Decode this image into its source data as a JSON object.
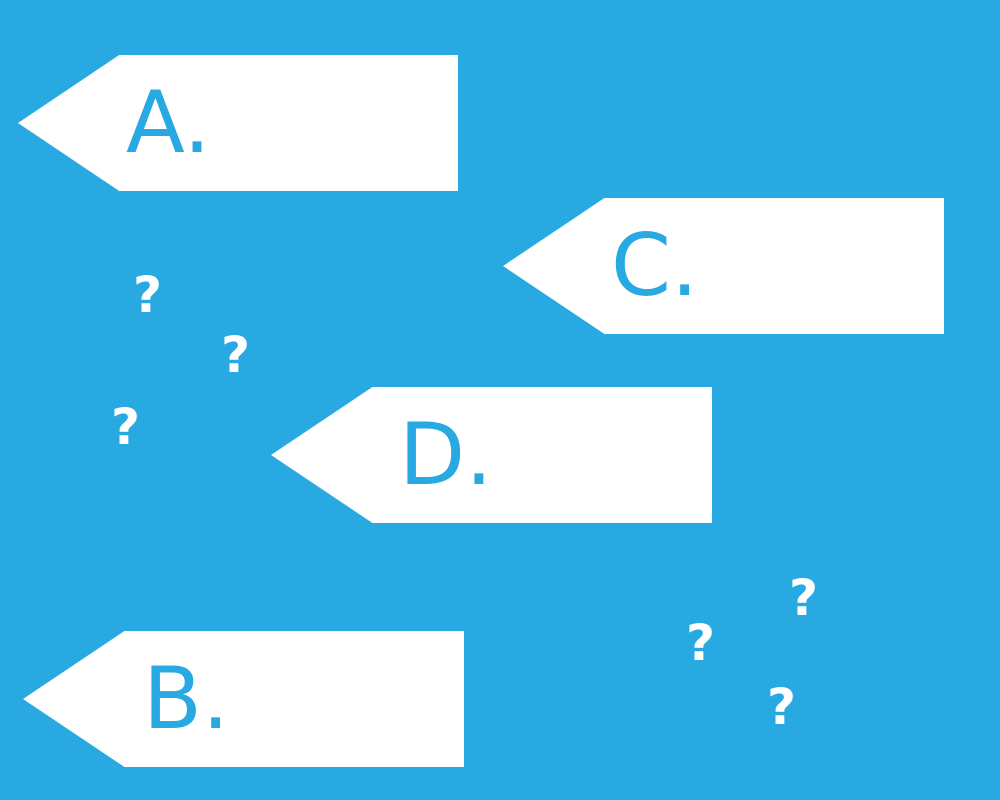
{
  "options": {
    "a": "A.",
    "b": "B.",
    "c": "C.",
    "d": "D."
  },
  "question_mark": "?",
  "colors": {
    "background": "#29a9e1",
    "arrow_fill": "#ffffff",
    "label_text": "#29a9e1",
    "question_mark": "#ffffff"
  }
}
